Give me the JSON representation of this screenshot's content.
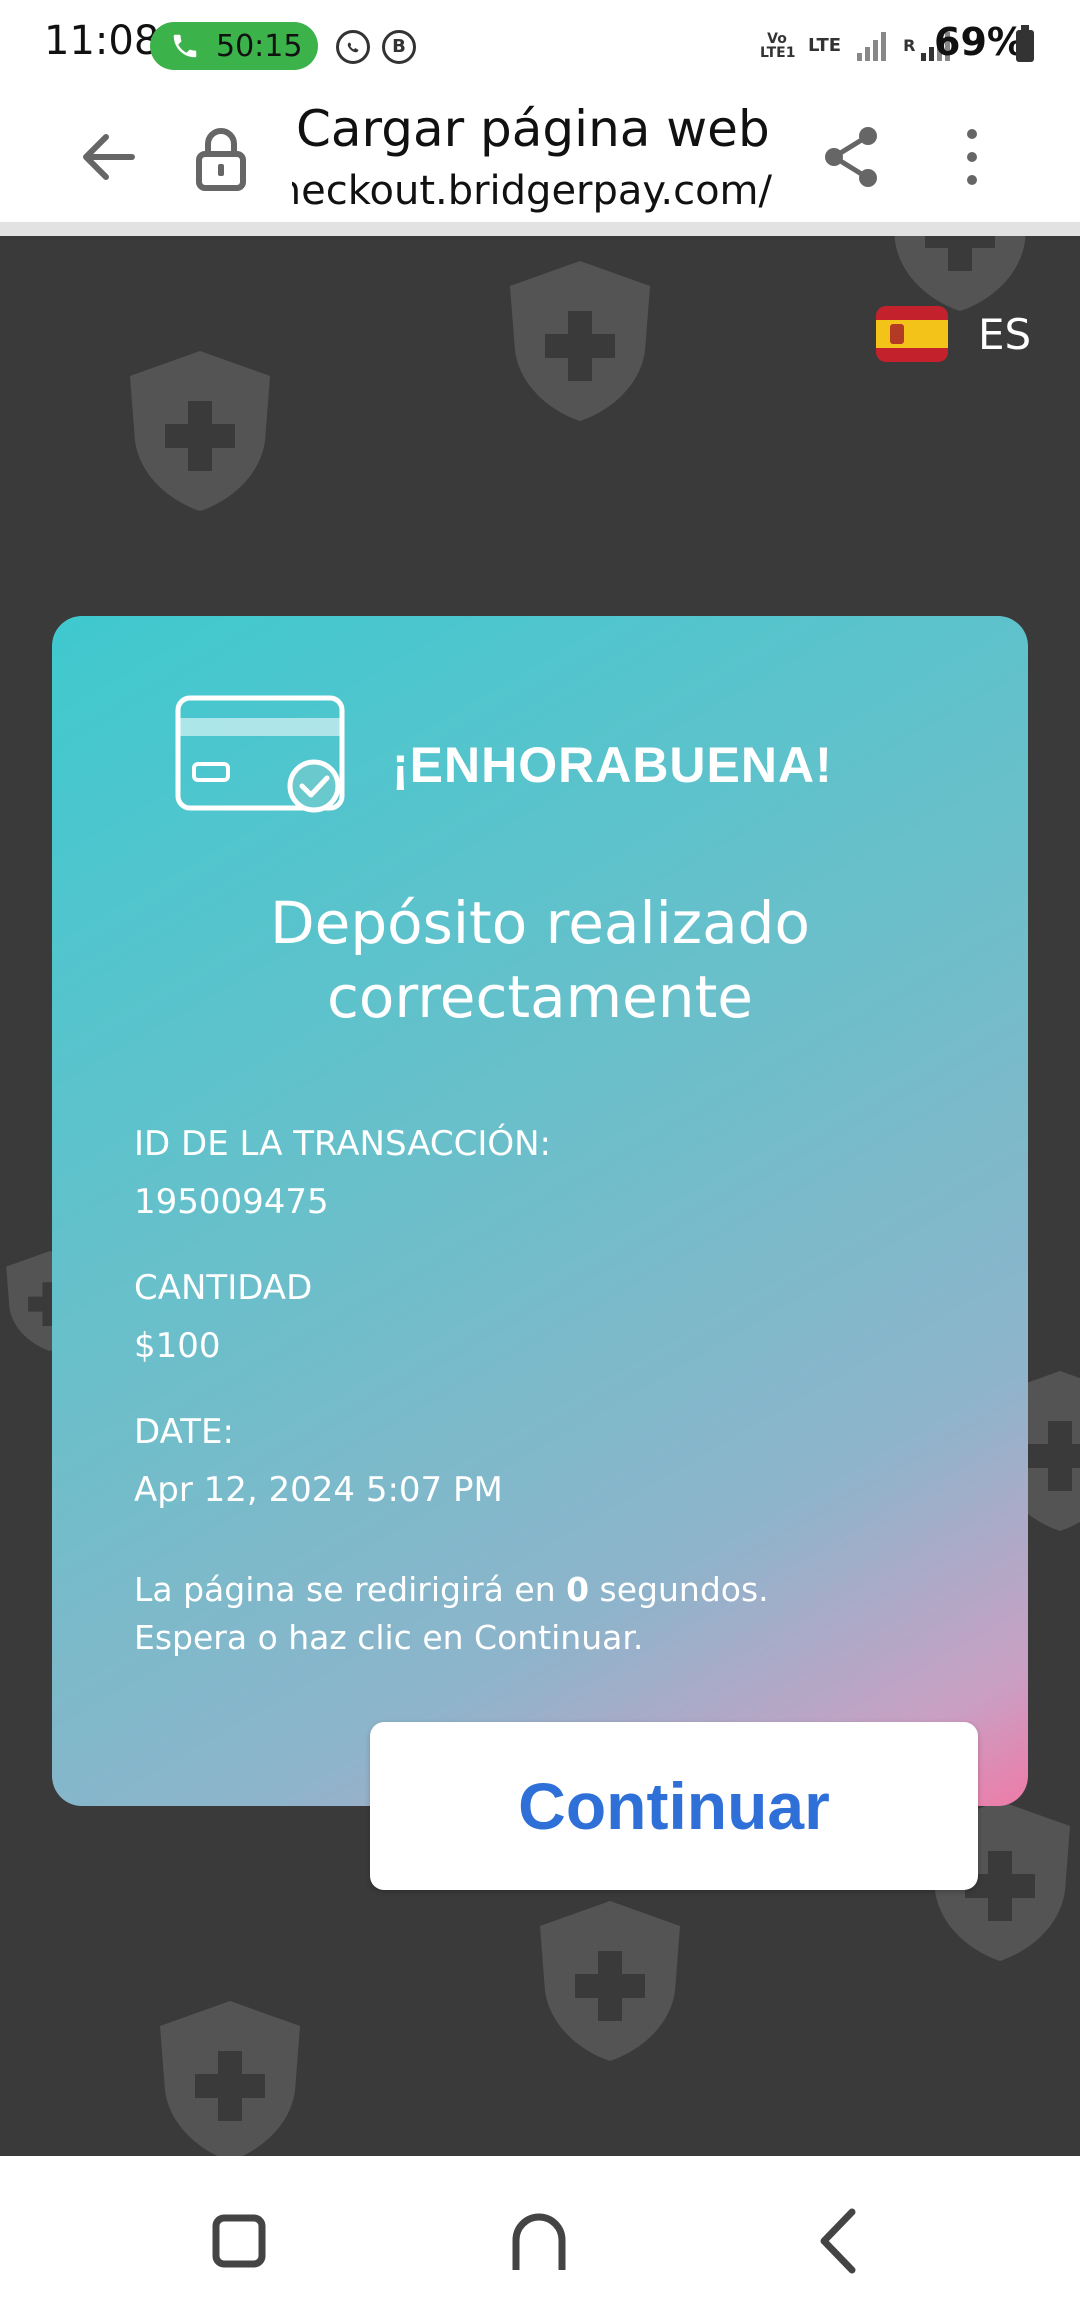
{
  "status_bar": {
    "time": "11:08",
    "call_timer": "50:15",
    "network_label_1": "Vo LTE1",
    "network_label_2": "LTE",
    "roaming_label": "R",
    "battery": "69%"
  },
  "browser": {
    "title": "Cargar página web",
    "url": "checkout.bridgerpay.com/"
  },
  "language": {
    "code": "ES"
  },
  "card": {
    "congrats": "¡ENHORABUENA!",
    "headline_line1": "Depósito realizado",
    "headline_line2": "correctamente",
    "transaction_label": "ID DE LA TRANSACCIÓN:",
    "transaction_value": "195009475",
    "amount_label": "CANTIDAD",
    "amount_value": "$100",
    "date_label": "DATE:",
    "date_value": "Apr 12, 2024 5:07 PM",
    "redirect_part1": "La página se redirigirá en ",
    "redirect_seconds": "0",
    "redirect_part2": " segundos.",
    "redirect_line2": "Espera o haz clic en Continuar."
  },
  "continue_label": "Continuar",
  "colors": {
    "accent_blue": "#2f6fd8",
    "call_green": "#3cb24b",
    "card_teal": "#3fc9cf",
    "card_pink": "#ee7ba8",
    "background": "#3a3a3a"
  }
}
